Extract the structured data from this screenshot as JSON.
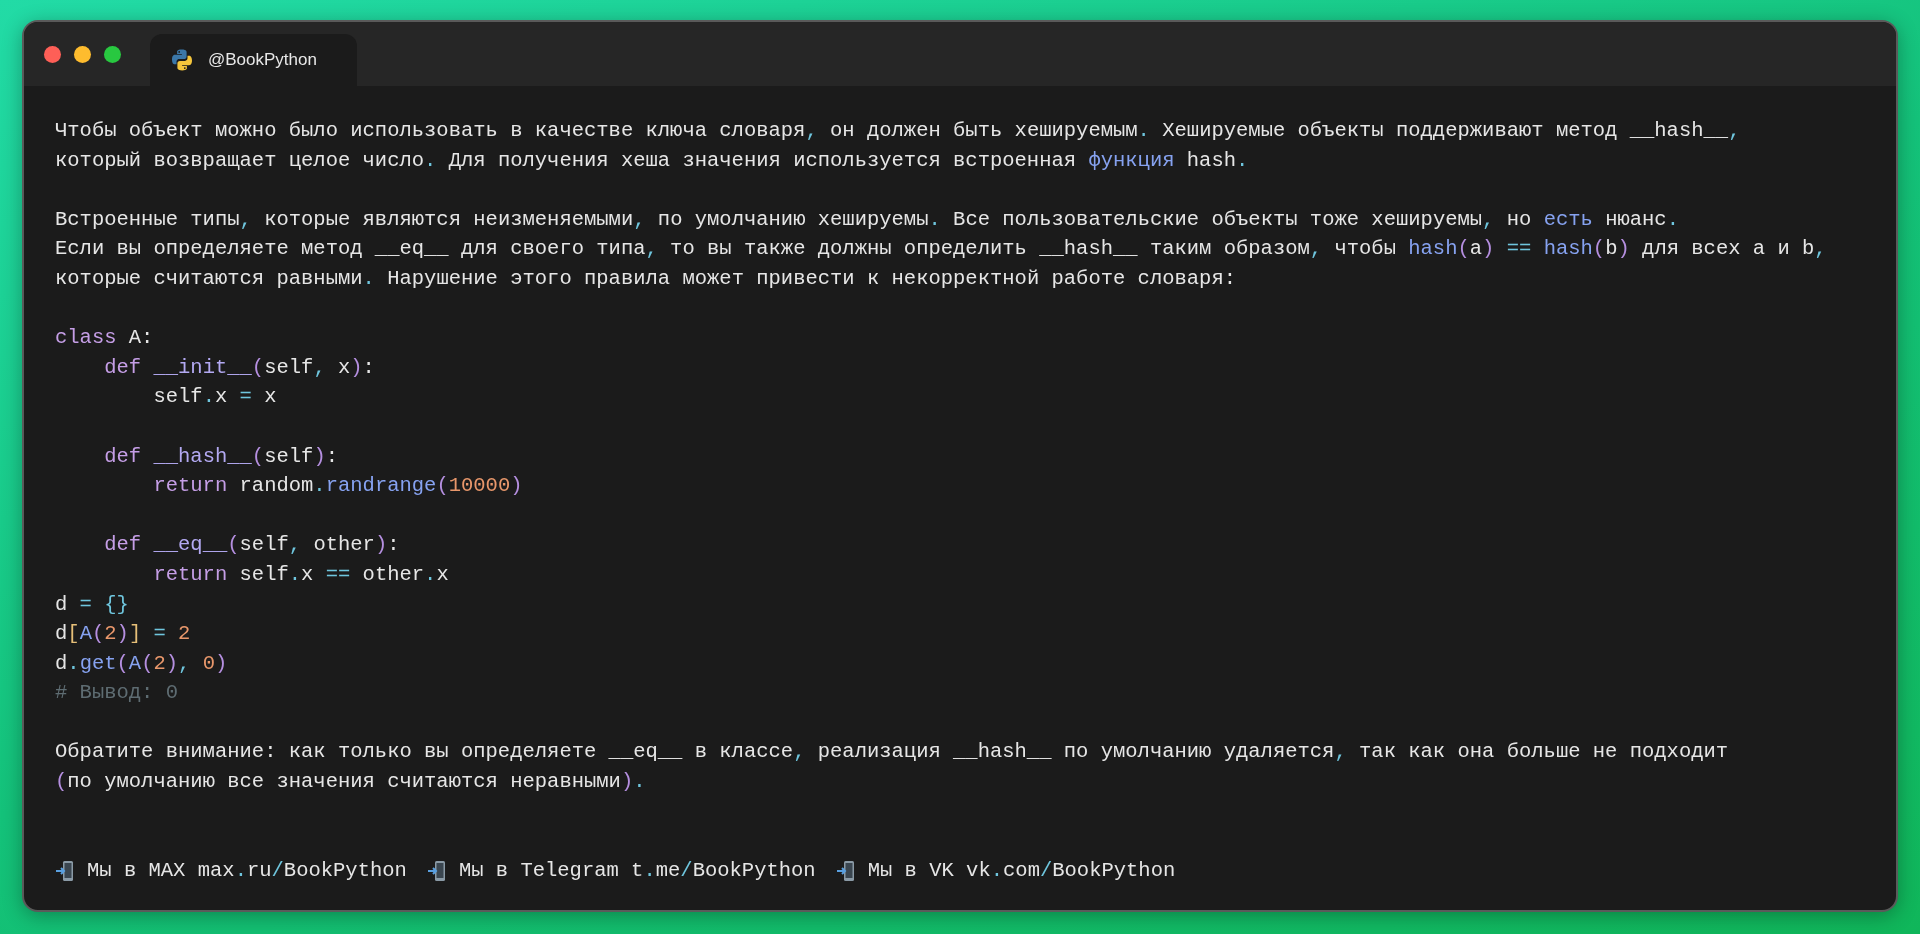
{
  "window": {
    "tab_title": "@BookPython"
  },
  "lines": [
    {
      "kind": "prose",
      "segments": [
        "Чтобы объект можно было использовать в качестве ключа словаря",
        {
          "kind": "p",
          "text": ","
        },
        " он должен быть хешируемым",
        {
          "kind": "p",
          "text": "."
        },
        " Хешируемые объекты поддерживают метод __hash__",
        {
          "kind": "p",
          "text": ","
        }
      ]
    },
    {
      "kind": "prose",
      "segments": [
        "который возвращает целое число",
        {
          "kind": "p",
          "text": "."
        },
        " Для получения хеша значения используется встроенная ",
        {
          "kind": "fn",
          "text": "функция"
        },
        " hash",
        {
          "kind": "p",
          "text": "."
        }
      ]
    },
    {
      "kind": "blank"
    },
    {
      "kind": "prose",
      "segments": [
        "Встроенные типы",
        {
          "kind": "p",
          "text": ","
        },
        " которые являются неизменяемыми",
        {
          "kind": "p",
          "text": ","
        },
        " по умолчанию хешируемы",
        {
          "kind": "p",
          "text": "."
        },
        " Все пользовательские объекты тоже хешируемы",
        {
          "kind": "p",
          "text": ","
        },
        " но ",
        {
          "kind": "fn",
          "text": "есть"
        },
        " нюанс",
        {
          "kind": "p",
          "text": "."
        }
      ]
    },
    {
      "kind": "prose",
      "segments": [
        "Если вы определяете метод __eq__ для своего типа",
        {
          "kind": "p",
          "text": ","
        },
        " то вы также должны определить __hash__ таким образом",
        {
          "kind": "p",
          "text": ","
        },
        " чтобы ",
        {
          "kind": "fn",
          "text": "hash"
        },
        {
          "kind": "pa",
          "text": "("
        },
        "a",
        {
          "kind": "pa",
          "text": ")"
        },
        {
          "kind": "p",
          "text": " == "
        },
        {
          "kind": "fn",
          "text": "hash"
        },
        {
          "kind": "pa",
          "text": "("
        },
        "b",
        {
          "kind": "pa",
          "text": ")"
        },
        " для всех a и b",
        {
          "kind": "p",
          "text": ","
        }
      ]
    },
    {
      "kind": "prose",
      "segments": [
        "которые считаются равными",
        {
          "kind": "p",
          "text": "."
        },
        " Нарушение этого правила может привести к некорректной работе словаря:"
      ]
    },
    {
      "kind": "blank"
    },
    {
      "kind": "code",
      "segments": [
        {
          "kind": "kw",
          "text": "class"
        },
        " A:"
      ]
    },
    {
      "kind": "code",
      "segments": [
        {
          "kind": "kw",
          "text": "    def"
        },
        {
          "kind": "mg",
          "text": " __init__"
        },
        {
          "kind": "pa",
          "text": "("
        },
        "self",
        {
          "kind": "p",
          "text": ","
        },
        " x",
        {
          "kind": "pa",
          "text": ")"
        },
        ":"
      ]
    },
    {
      "kind": "code",
      "segments": [
        "        self",
        {
          "kind": "p",
          "text": "."
        },
        "x ",
        {
          "kind": "p",
          "text": "="
        },
        " x"
      ]
    },
    {
      "kind": "blank"
    },
    {
      "kind": "code",
      "segments": [
        {
          "kind": "kw",
          "text": "    def"
        },
        {
          "kind": "mg",
          "text": " __hash__"
        },
        {
          "kind": "pa",
          "text": "("
        },
        "self",
        {
          "kind": "pa",
          "text": ")"
        },
        ":"
      ]
    },
    {
      "kind": "code",
      "segments": [
        {
          "kind": "kw",
          "text": "        return"
        },
        " random",
        {
          "kind": "p",
          "text": "."
        },
        {
          "kind": "fn",
          "text": "randrange"
        },
        {
          "kind": "pa",
          "text": "("
        },
        {
          "kind": "num",
          "text": "10000"
        },
        {
          "kind": "pa",
          "text": ")"
        }
      ]
    },
    {
      "kind": "blank"
    },
    {
      "kind": "code",
      "segments": [
        {
          "kind": "kw",
          "text": "    def"
        },
        {
          "kind": "mg",
          "text": " __eq__"
        },
        {
          "kind": "pa",
          "text": "("
        },
        "self",
        {
          "kind": "p",
          "text": ","
        },
        " other",
        {
          "kind": "pa",
          "text": ")"
        },
        ":"
      ]
    },
    {
      "kind": "code",
      "segments": [
        {
          "kind": "kw",
          "text": "        return"
        },
        " self",
        {
          "kind": "p",
          "text": "."
        },
        "x ",
        {
          "kind": "p",
          "text": "=="
        },
        " other",
        {
          "kind": "p",
          "text": "."
        },
        "x"
      ]
    },
    {
      "kind": "code",
      "segments": [
        "d ",
        {
          "kind": "p",
          "text": "= {}"
        }
      ]
    },
    {
      "kind": "code",
      "segments": [
        "d",
        {
          "kind": "br",
          "text": "["
        },
        {
          "kind": "fn",
          "text": "A"
        },
        {
          "kind": "pa",
          "text": "("
        },
        {
          "kind": "num",
          "text": "2"
        },
        {
          "kind": "pa",
          "text": ")"
        },
        {
          "kind": "br",
          "text": "]"
        },
        {
          "kind": "p",
          "text": " = "
        },
        {
          "kind": "num",
          "text": "2"
        }
      ]
    },
    {
      "kind": "code",
      "segments": [
        "d",
        {
          "kind": "p",
          "text": "."
        },
        {
          "kind": "fn",
          "text": "get"
        },
        {
          "kind": "pa",
          "text": "("
        },
        {
          "kind": "fn",
          "text": "A"
        },
        {
          "kind": "pa",
          "text": "("
        },
        {
          "kind": "num",
          "text": "2"
        },
        {
          "kind": "pa",
          "text": ")"
        },
        {
          "kind": "p",
          "text": ","
        },
        {
          "kind": "num",
          "text": " 0"
        },
        {
          "kind": "pa",
          "text": ")"
        }
      ]
    },
    {
      "kind": "code",
      "segments": [
        {
          "kind": "com",
          "text": "# Вывод: 0"
        }
      ]
    },
    {
      "kind": "blank"
    },
    {
      "kind": "prose",
      "segments": [
        "Обратите внимание: как только вы определяете __eq__ в классе",
        {
          "kind": "p",
          "text": ","
        },
        " реализация __hash__ по умолчанию удаляется",
        {
          "kind": "p",
          "text": ","
        },
        " так как она больше не подходит"
      ]
    },
    {
      "kind": "prose",
      "segments": [
        {
          "kind": "pa",
          "text": "("
        },
        "по умолчанию все значения считаются неравными",
        {
          "kind": "pa",
          "text": ")"
        },
        {
          "kind": "p",
          "text": "."
        }
      ]
    },
    {
      "kind": "blank"
    },
    {
      "kind": "blank"
    }
  ],
  "footer": [
    {
      "segments": [
        "Мы в MAX max",
        {
          "kind": "p",
          "text": "."
        },
        "ru",
        {
          "kind": "p",
          "text": "/"
        },
        "BookPython"
      ]
    },
    {
      "segments": [
        "Мы в Telegram t",
        {
          "kind": "p",
          "text": "."
        },
        "me",
        {
          "kind": "p",
          "text": "/"
        },
        "BookPython"
      ]
    },
    {
      "segments": [
        "Мы в VK vk",
        {
          "kind": "p",
          "text": "."
        },
        "com",
        {
          "kind": "p",
          "text": "/"
        },
        "BookPython"
      ]
    }
  ]
}
